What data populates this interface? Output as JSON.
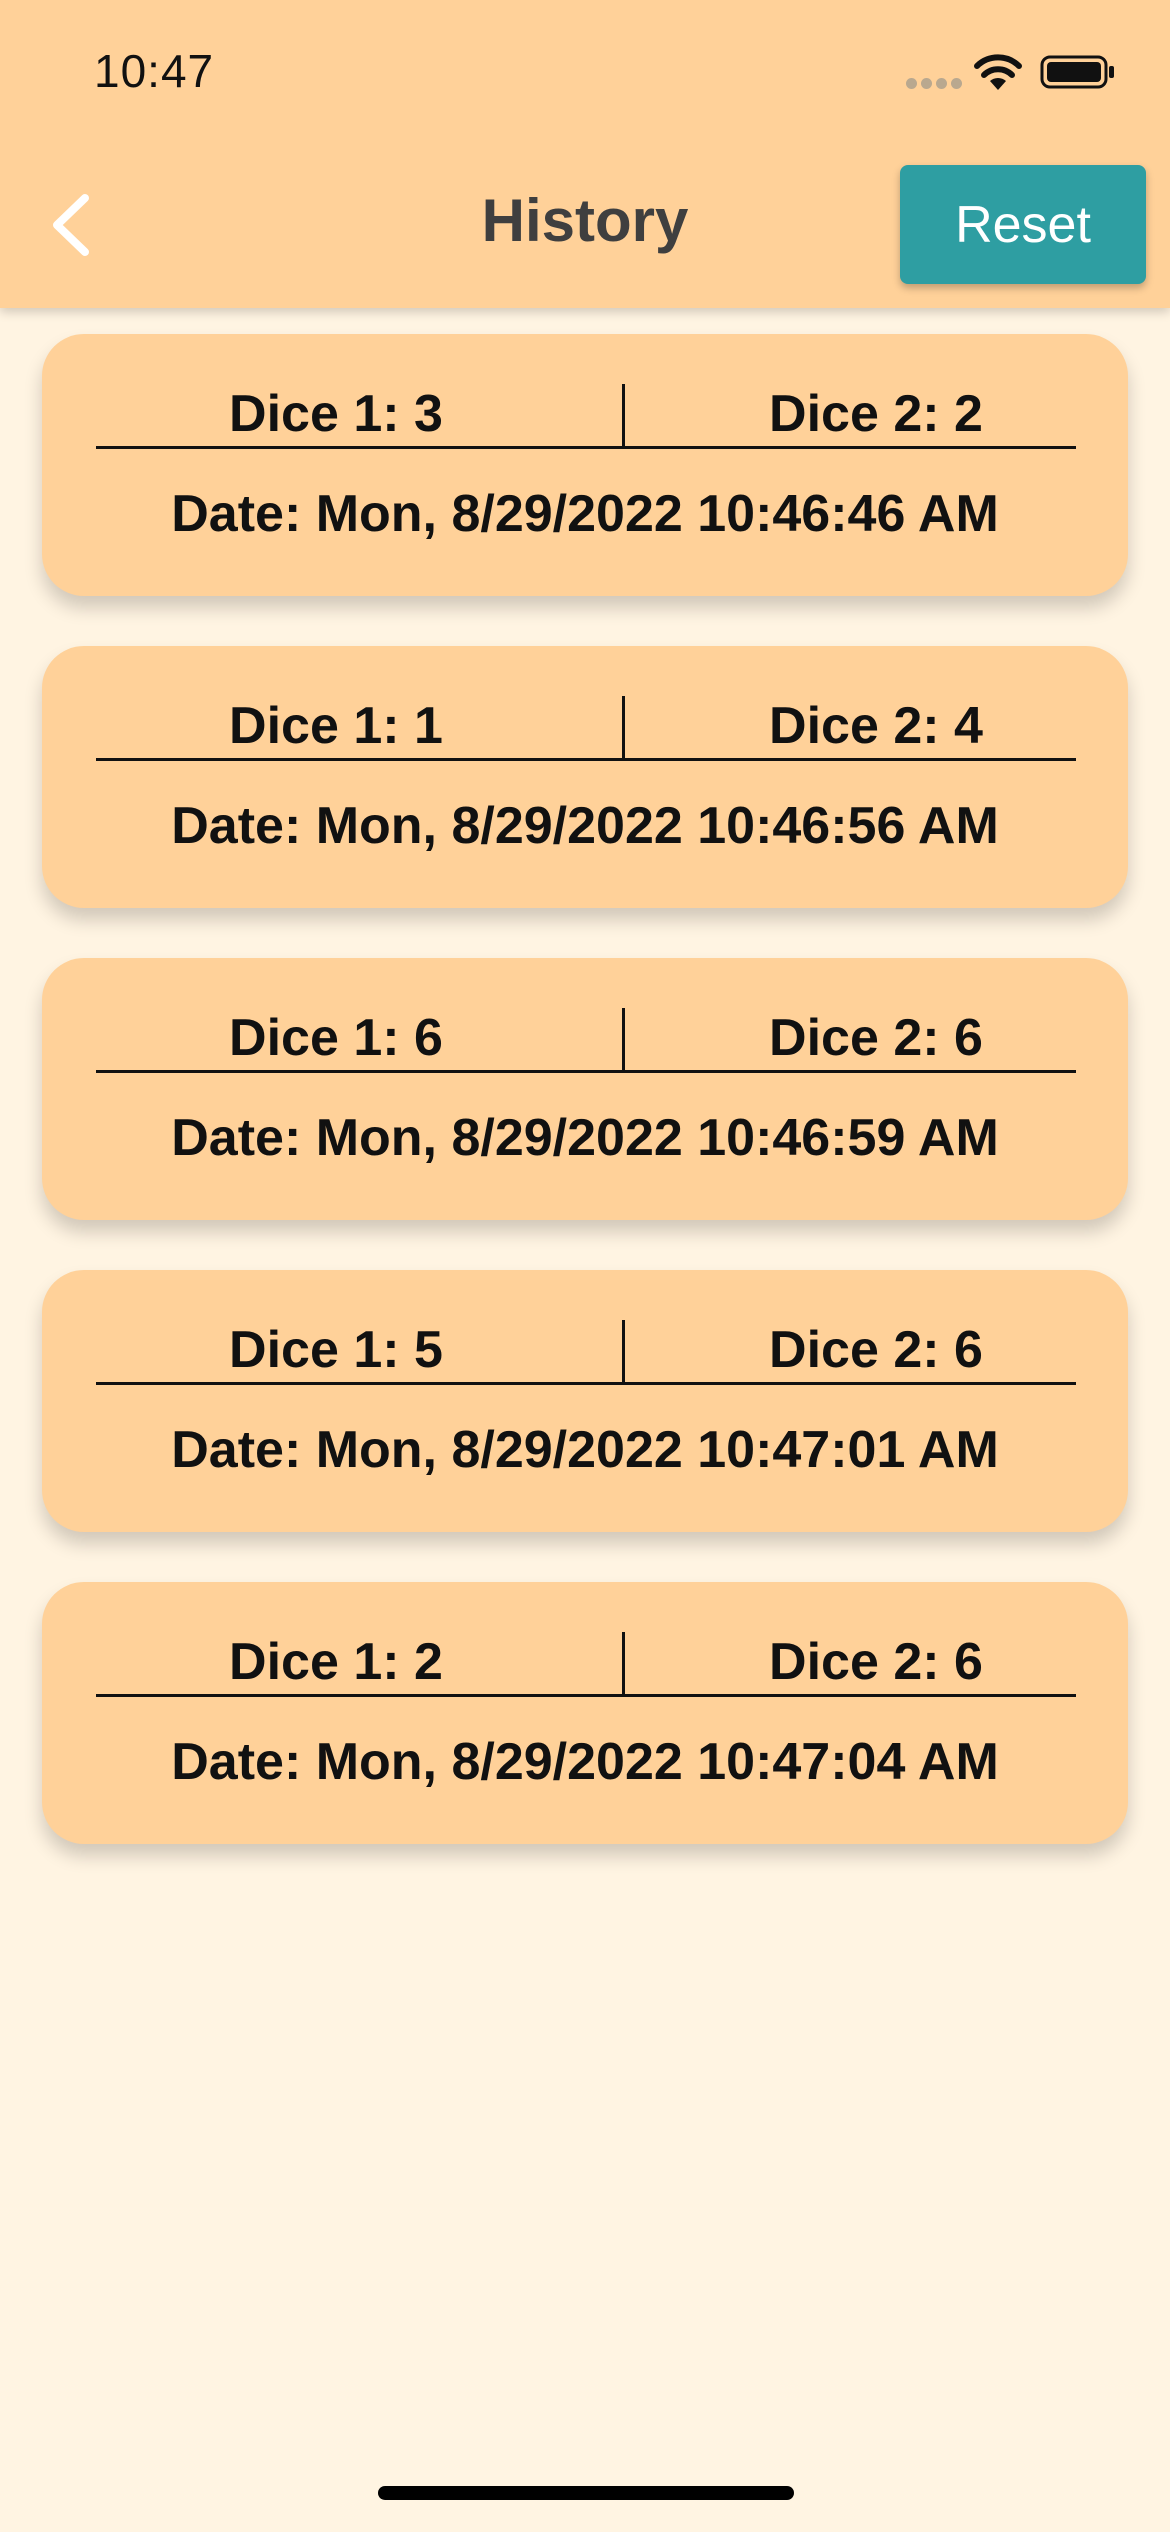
{
  "status_bar": {
    "time": "10:47"
  },
  "header": {
    "title": "History",
    "reset_label": "Reset"
  },
  "icons": {
    "back": "chevron-left-icon",
    "wifi": "wifi-icon",
    "battery": "battery-icon",
    "signal": "signal-dots-icon"
  },
  "colors": {
    "header_bg": "#ffd199",
    "page_bg": "#fff4e2",
    "card_bg": "#ffd199",
    "reset_button": "#2e9ea2"
  },
  "history": [
    {
      "dice1": "Dice 1: 3",
      "dice2": "Dice 2: 2",
      "date": "Date: Mon, 8/29/2022 10:46:46 AM"
    },
    {
      "dice1": "Dice 1: 1",
      "dice2": "Dice 2: 4",
      "date": "Date: Mon, 8/29/2022 10:46:56 AM"
    },
    {
      "dice1": "Dice 1: 6",
      "dice2": "Dice 2: 6",
      "date": "Date: Mon, 8/29/2022 10:46:59 AM"
    },
    {
      "dice1": "Dice 1: 5",
      "dice2": "Dice 2: 6",
      "date": "Date: Mon, 8/29/2022 10:47:01 AM"
    },
    {
      "dice1": "Dice 1: 2",
      "dice2": "Dice 2: 6",
      "date": "Date: Mon, 8/29/2022 10:47:04 AM"
    }
  ]
}
